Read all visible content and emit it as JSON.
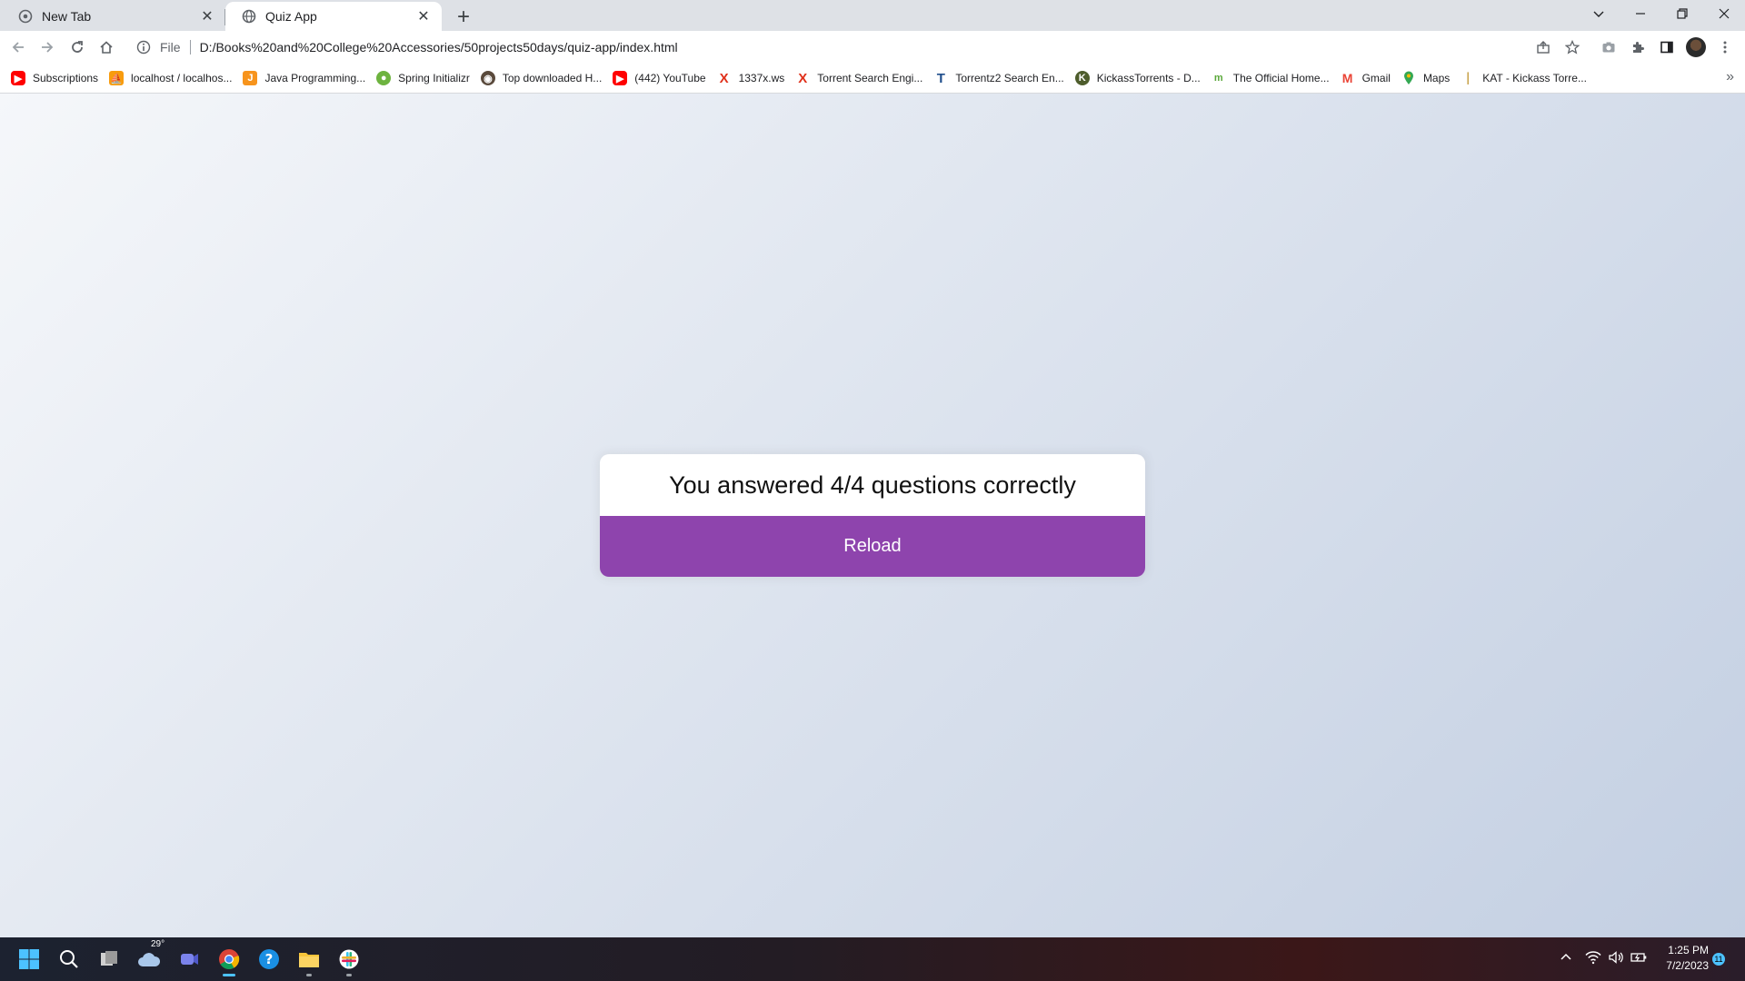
{
  "browser": {
    "tabs": [
      {
        "title": "New Tab",
        "active": false
      },
      {
        "title": "Quiz App",
        "active": true
      }
    ],
    "address": {
      "scheme": "File",
      "url": "D:/Books%20and%20College%20Accessories/50projects50days/quiz-app/index.html"
    },
    "bookmarks": [
      {
        "label": "Subscriptions",
        "icon": "youtube-icon",
        "color": "#ff0000"
      },
      {
        "label": "localhost / localhos...",
        "icon": "phpmyadmin-icon",
        "color": "#f89c0e"
      },
      {
        "label": "Java Programming...",
        "icon": "javatpoint-icon",
        "color": "#f7941d"
      },
      {
        "label": "Spring Initializr",
        "icon": "spring-icon",
        "color": "#6db33f"
      },
      {
        "label": "Top downloaded H...",
        "icon": "torrent-site-icon",
        "color": "#5a4a3c"
      },
      {
        "label": "(442) YouTube",
        "icon": "youtube-icon",
        "color": "#ff0000"
      },
      {
        "label": "1337x.ws",
        "icon": "x-icon",
        "color": "#e0311b"
      },
      {
        "label": "Torrent Search Engi...",
        "icon": "x-icon",
        "color": "#e0311b"
      },
      {
        "label": "Torrentz2 Search En...",
        "icon": "torrentz-icon",
        "color": "#1f4e8c"
      },
      {
        "label": "KickassTorrents - D...",
        "icon": "kickass-icon",
        "color": "#4e5d2c"
      },
      {
        "label": "The Official Home...",
        "icon": "m-icon",
        "color": "#5aa83a"
      },
      {
        "label": "Gmail",
        "icon": "gmail-icon",
        "color": "#ea4335"
      },
      {
        "label": "Maps",
        "icon": "maps-icon",
        "color": "#34a853"
      },
      {
        "label": "KAT - Kickass Torre...",
        "icon": "kat-icon",
        "color": "#c8a24a"
      }
    ]
  },
  "quiz": {
    "result_text": "You answered 4/4 questions correctly",
    "reload_label": "Reload",
    "accent_color": "#8e44ad"
  },
  "taskbar": {
    "weather_temp": "29°",
    "time": "1:25 PM",
    "date": "7/2/2023",
    "notification_count": "11"
  }
}
